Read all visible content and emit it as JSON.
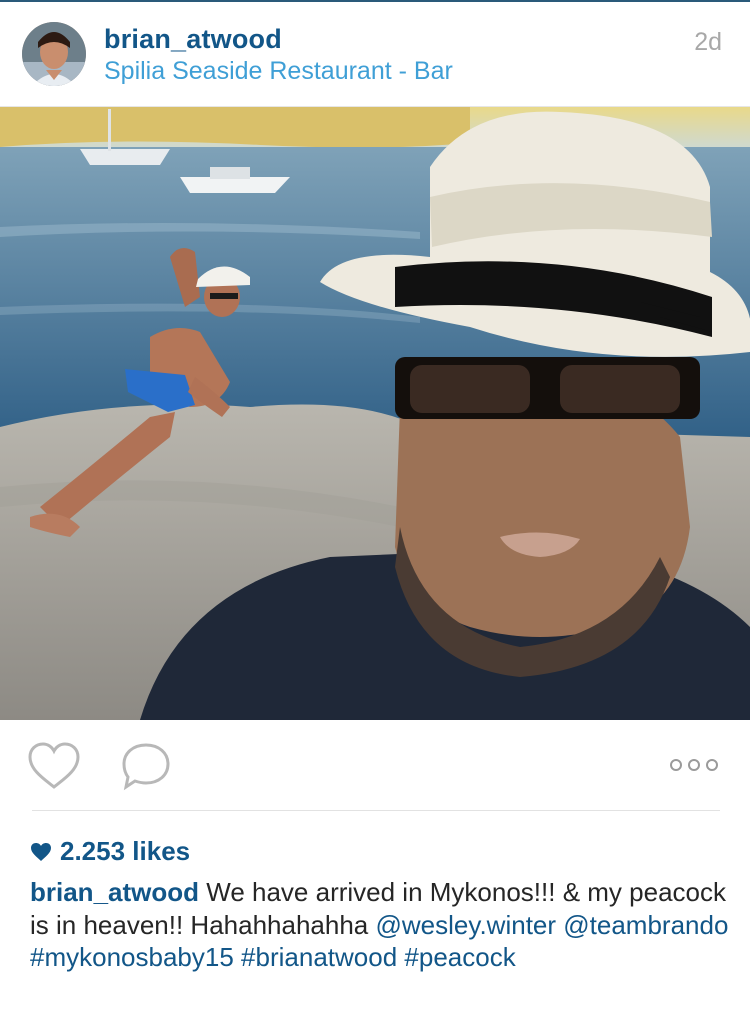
{
  "post": {
    "username": "brian_atwood",
    "location": "Spilia Seaside Restaurant - Bar",
    "time_ago": "2d",
    "likes": "2.253 likes",
    "caption": {
      "username": "brian_atwood",
      "text": "We have arrived in Mykonos!!! & my peacock is in heaven!! Hahahhahahha",
      "mentions_and_tags": [
        "@wesley.winter",
        "@teambrando",
        "#mykonosbaby15",
        "#brianatwood",
        "#peacock"
      ]
    }
  },
  "actions": {
    "like_icon": "heart-outline-icon",
    "comment_icon": "speech-bubble-icon",
    "more_icon": "ellipsis-icon"
  },
  "colors": {
    "username_blue": "#125688",
    "location_blue": "#3f9fd6",
    "timestamp_gray": "#a8a8a8"
  }
}
